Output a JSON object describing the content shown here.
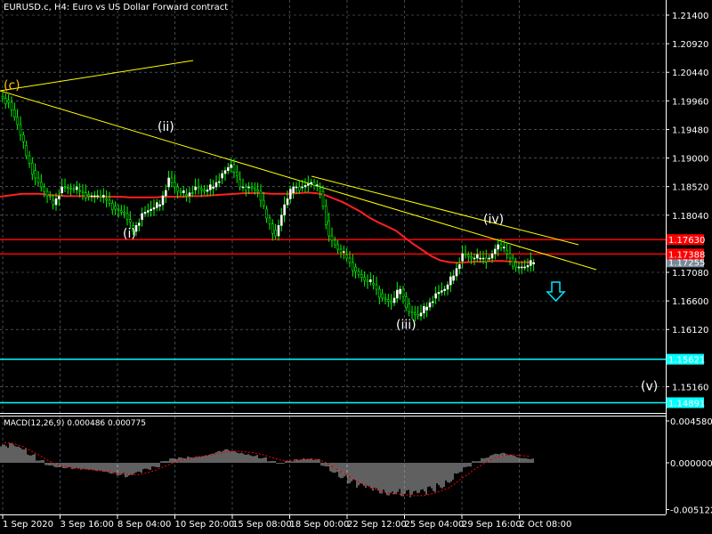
{
  "header": {
    "title": "EURUSD.c, H4:  Euro vs US Dollar Forward contract"
  },
  "macd": {
    "label": "MACD(12,26,9) 0.000486 0.000775",
    "ticks": [
      "0.004580",
      "0.000000",
      "-0.005122"
    ]
  },
  "colors": {
    "bull": "#ffffff",
    "wick": "#00ff00",
    "ma": "#ff2020",
    "trend": "#ffff00",
    "cyan": "#00ffff",
    "red": "#ff0000",
    "grid": "#6a7888"
  },
  "chart_data": {
    "type": "candlestick",
    "price_ticks": [
      "1.21400",
      "1.20920",
      "1.20440",
      "1.19960",
      "1.19480",
      "1.19000",
      "1.18520",
      "1.18040",
      "1.17080",
      "1.16600",
      "1.16120",
      "1.15160"
    ],
    "time_ticks": [
      "1 Sep 2020",
      "3 Sep 16:00",
      "8 Sep 04:00",
      "10 Sep 20:00",
      "15 Sep 08:00",
      "18 Sep 00:00",
      "22 Sep 12:00",
      "25 Sep 04:00",
      "29 Sep 16:00",
      "2 Oct 08:00"
    ],
    "closes": [
      1.19935,
      1.19561,
      1.19038,
      1.18665,
      1.1844,
      1.18216,
      1.18515,
      1.18485,
      1.1844,
      1.18366,
      1.18366,
      1.18291,
      1.18141,
      1.18067,
      1.17768,
      1.18067,
      1.18141,
      1.18216,
      1.18665,
      1.1844,
      1.18366,
      1.18515,
      1.1844,
      1.18515,
      1.18739,
      1.18889,
      1.18515,
      1.18515,
      1.1844,
      1.17992,
      1.17693,
      1.18216,
      1.18515,
      1.18515,
      1.1859,
      1.1844,
      1.17693,
      1.17469,
      1.17319,
      1.17095,
      1.16946,
      1.16871,
      1.16647,
      1.16572,
      1.16796,
      1.16422,
      1.16348,
      1.16497,
      1.16722,
      1.16796,
      1.1702,
      1.17394,
      1.17319,
      1.17319,
      1.17319,
      1.17544,
      1.17394,
      1.1717,
      1.1717,
      1.17245
    ],
    "ma": [
      1.1835,
      1.1838,
      1.184,
      1.184,
      1.184,
      1.1838,
      1.1837,
      1.1836,
      1.1836,
      1.1836,
      1.1835,
      1.1835,
      1.1835,
      1.1835,
      1.1834,
      1.1834,
      1.1834,
      1.1834,
      1.1835,
      1.1835,
      1.1835,
      1.1836,
      1.1836,
      1.1837,
      1.1838,
      1.1839,
      1.184,
      1.1841,
      1.1841,
      1.1841,
      1.184,
      1.184,
      1.184,
      1.1841,
      1.1842,
      1.1841,
      1.1838,
      1.1832,
      1.1826,
      1.1818,
      1.181,
      1.18,
      1.1792,
      1.1785,
      1.1778,
      1.1766,
      1.1755,
      1.1745,
      1.1735,
      1.1728,
      1.1725,
      1.1724,
      1.1725,
      1.1726,
      1.1726,
      1.1727,
      1.1727,
      1.1726,
      1.1725,
      1.1725
    ],
    "macd_hist": [
      0.002,
      0.0022,
      0.0018,
      0.001,
      0.0003,
      -0.0003,
      -0.0005,
      -0.0006,
      -0.0007,
      -0.0008,
      -0.0009,
      -0.001,
      -0.0012,
      -0.0014,
      -0.0016,
      -0.0012,
      -0.0008,
      -0.0005,
      0.0002,
      0.0005,
      0.0006,
      0.0007,
      0.0008,
      0.001,
      0.0013,
      0.0015,
      0.0013,
      0.0011,
      0.0009,
      0.0006,
      0.0002,
      -0.0001,
      0.0002,
      0.0004,
      0.0005,
      0.0004,
      -0.0004,
      -0.0011,
      -0.0017,
      -0.0023,
      -0.0028,
      -0.0031,
      -0.0034,
      -0.0036,
      -0.0035,
      -0.0037,
      -0.0038,
      -0.0036,
      -0.0032,
      -0.0028,
      -0.0022,
      -0.0012,
      -0.0005,
      0.0002,
      0.0006,
      0.001,
      0.0011,
      0.0009,
      0.0006,
      0.0005
    ],
    "macd_signal": [
      0.0022,
      0.0021,
      0.0018,
      0.0013,
      0.0008,
      0.0002,
      -0.0002,
      -0.0004,
      -0.0006,
      -0.0007,
      -0.0008,
      -0.0009,
      -0.001,
      -0.0012,
      -0.0013,
      -0.0013,
      -0.0011,
      -0.0008,
      -0.0004,
      0.0,
      0.0003,
      0.0005,
      0.0007,
      0.0008,
      0.001,
      0.0012,
      0.0013,
      0.0012,
      0.0011,
      0.0009,
      0.0006,
      0.0003,
      0.0002,
      0.0003,
      0.0004,
      0.0004,
      0.0001,
      -0.0005,
      -0.0011,
      -0.0017,
      -0.0022,
      -0.0026,
      -0.003,
      -0.0033,
      -0.0034,
      -0.0035,
      -0.0036,
      -0.0036,
      -0.0034,
      -0.0031,
      -0.0027,
      -0.002,
      -0.0013,
      -0.0006,
      0.0,
      0.0005,
      0.0008,
      0.0009,
      0.0008,
      0.0007
    ],
    "levels": [
      {
        "price": 1.1763,
        "label": "1.17630",
        "color": "#ff0000"
      },
      {
        "price": 1.17388,
        "label": "1.17388",
        "color": "#ff0000"
      },
      {
        "price": 1.15621,
        "label": "1.15621",
        "color": "#00ffff"
      },
      {
        "price": 1.14891,
        "label": "1.14891",
        "color": "#00ffff"
      }
    ],
    "bid_label": "1.17255",
    "wave_labels": [
      {
        "text": "(c)",
        "price": 1.2015,
        "color": "#ffc000"
      },
      {
        "text": "(ii)",
        "price": 1.1946
      },
      {
        "text": "(i)",
        "price": 1.1766
      },
      {
        "text": "(iii)",
        "price": 1.1613
      },
      {
        "text": "(iv)",
        "price": 1.179
      },
      {
        "text": "(v)",
        "price": 1.151
      }
    ]
  }
}
